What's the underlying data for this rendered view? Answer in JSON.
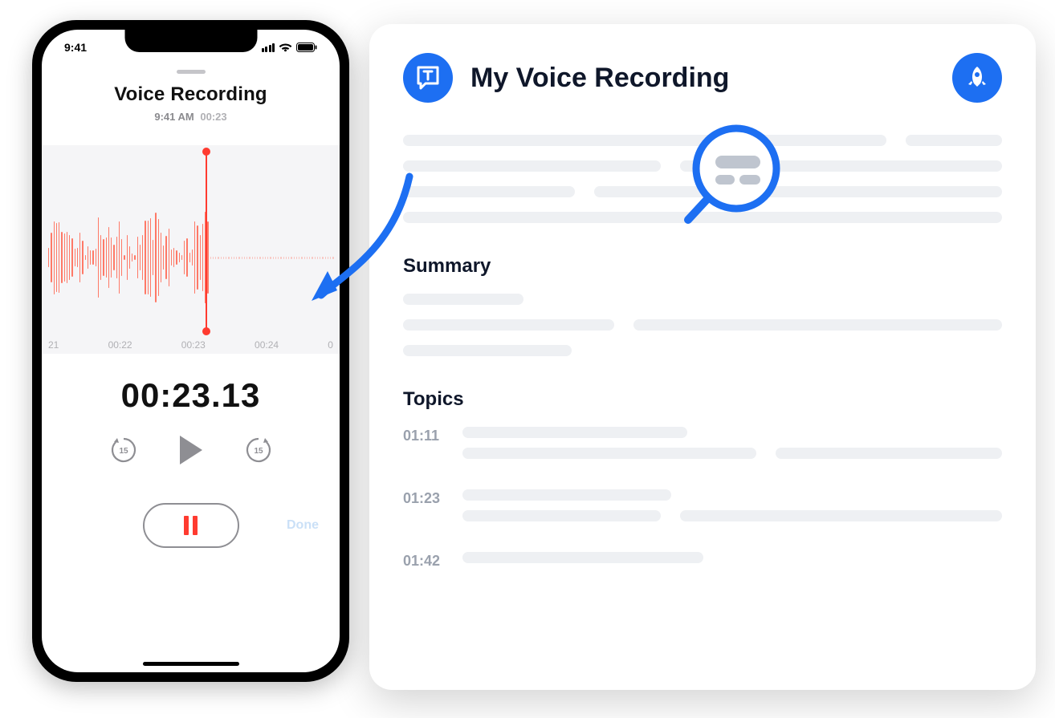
{
  "phone": {
    "status_time": "9:41",
    "title": "Voice Recording",
    "sub_time": "9:41 AM",
    "sub_duration": "00:23",
    "ticks": [
      "21",
      "00:22",
      "00:23",
      "00:24",
      "0"
    ],
    "timer": "00:23.13",
    "skip_back_label": "15",
    "skip_fwd_label": "15",
    "done_label": "Done"
  },
  "panel": {
    "title": "My Voice Recording",
    "summary_heading": "Summary",
    "topics_heading": "Topics",
    "topics": [
      {
        "time": "01:11"
      },
      {
        "time": "01:23"
      },
      {
        "time": "01:42"
      }
    ]
  },
  "colors": {
    "accent_blue": "#1d6ff2",
    "accent_red": "#ff3b30"
  }
}
